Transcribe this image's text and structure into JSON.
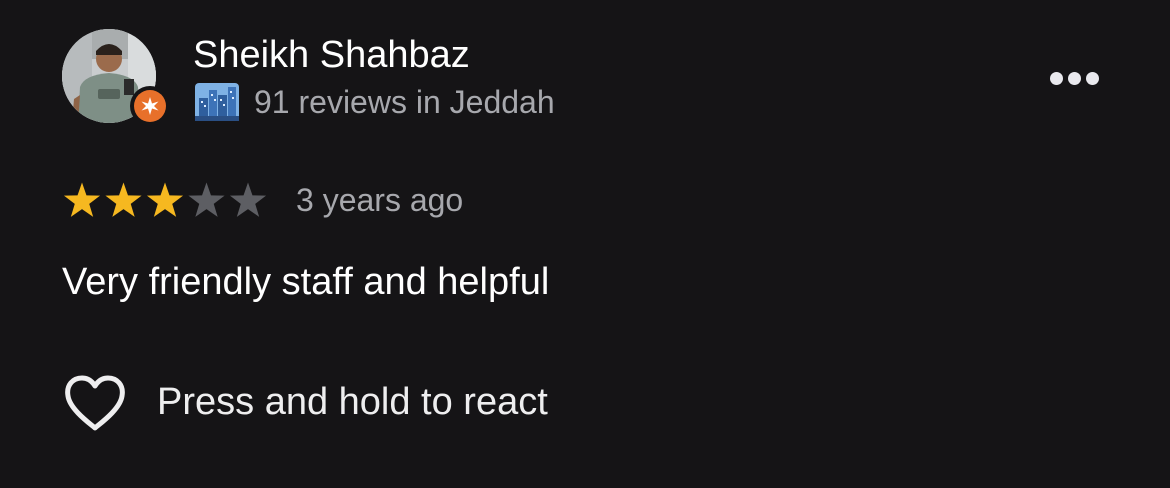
{
  "reviewer": {
    "name": "Sheikh Shahbaz",
    "reviews_summary": "91 reviews in Jeddah",
    "avatar_icon": "profile-photo",
    "badge_icon": "local-guide-badge-icon",
    "badge_color": "#e8702a",
    "city_icon": "cityscape-icon"
  },
  "review": {
    "rating": 3,
    "max_rating": 5,
    "time": "3 years ago",
    "text": "Very friendly staff and helpful",
    "star_filled_color": "#f6b820",
    "star_empty_color": "#5d5e63"
  },
  "actions": {
    "more_icon": "more-horizontal-icon",
    "react_icon": "heart-outline-icon",
    "react_label": "Press and hold to react"
  },
  "theme": {
    "background": "#151416",
    "primary_text": "#ffffff",
    "secondary_text": "#a7a8ad"
  }
}
